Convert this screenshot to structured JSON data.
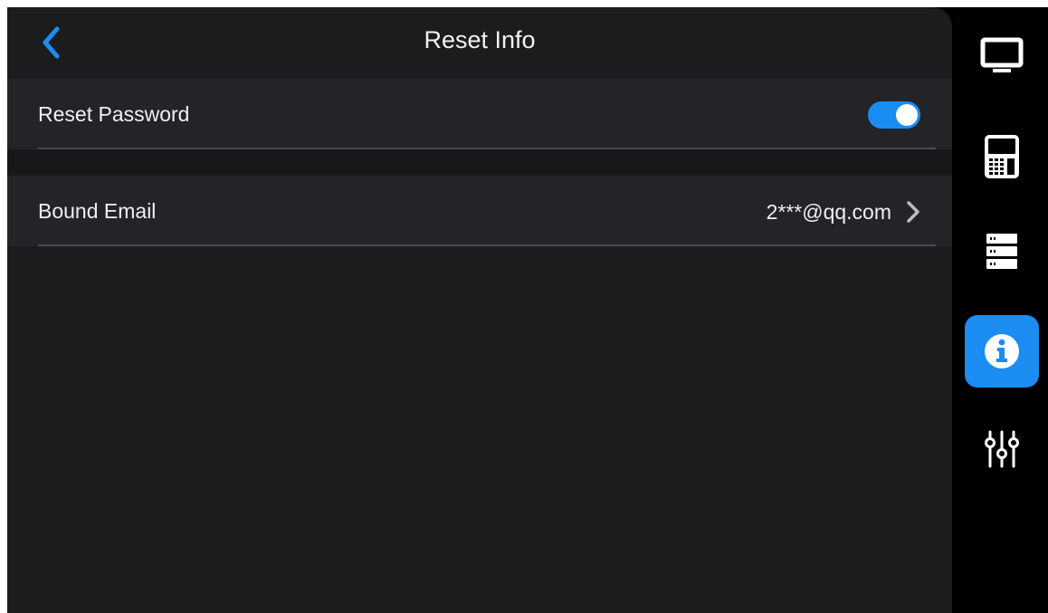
{
  "header": {
    "title": "Reset Info",
    "back_icon": "chevron-left-icon"
  },
  "settings": {
    "reset_password": {
      "label": "Reset Password",
      "enabled": true
    },
    "bound_email": {
      "label": "Bound Email",
      "value": "2***@qq.com",
      "icon": "chevron-right-icon"
    }
  },
  "sidebar": {
    "items": [
      {
        "icon": "monitor-icon",
        "active": false
      },
      {
        "icon": "keypad-device-icon",
        "active": false
      },
      {
        "icon": "server-icon",
        "active": false
      },
      {
        "icon": "info-icon",
        "active": true
      },
      {
        "icon": "sliders-icon",
        "active": false
      }
    ]
  },
  "colors": {
    "accent": "#1b8cf2",
    "background": "#1b1c1e",
    "row": "#232427",
    "sidebar": "#000000",
    "text": "#f0f0f0"
  }
}
